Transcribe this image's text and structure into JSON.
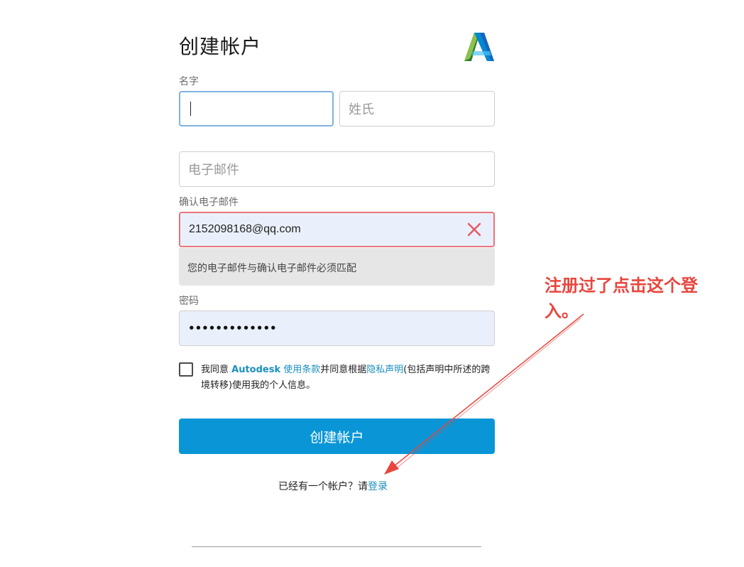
{
  "form": {
    "title": "创建帐户",
    "first_name": {
      "label": "名字",
      "value": "",
      "placeholder": ""
    },
    "last_name": {
      "placeholder": "姓氏"
    },
    "email": {
      "placeholder": "电子邮件"
    },
    "confirm_email": {
      "label": "确认电子邮件",
      "value": "2152098168@qq.com",
      "error": "您的电子邮件与确认电子邮件必须匹配"
    },
    "password": {
      "label": "密码",
      "value": "•••••••••••••"
    },
    "agreement": {
      "prefix": "我同意 ",
      "brand": "Autodesk",
      "terms_link": "使用条款",
      "middle": "并同意根据",
      "privacy_link": "隐私声明",
      "suffix": "(包括声明中所述的跨境转移)使用我的个人信息。"
    },
    "submit_label": "创建帐户",
    "signin_prompt": "已经有一个帐户？请",
    "signin_link": "登录"
  },
  "annotation": {
    "text": "注册过了点击这个登入。"
  },
  "colors": {
    "primary_button": "#0a96d6",
    "link": "#1a8fbf",
    "error_border": "#e8747a",
    "annotation": "#e8463e"
  },
  "icons": {
    "logo": "autodesk-logo",
    "clear": "close-icon"
  }
}
